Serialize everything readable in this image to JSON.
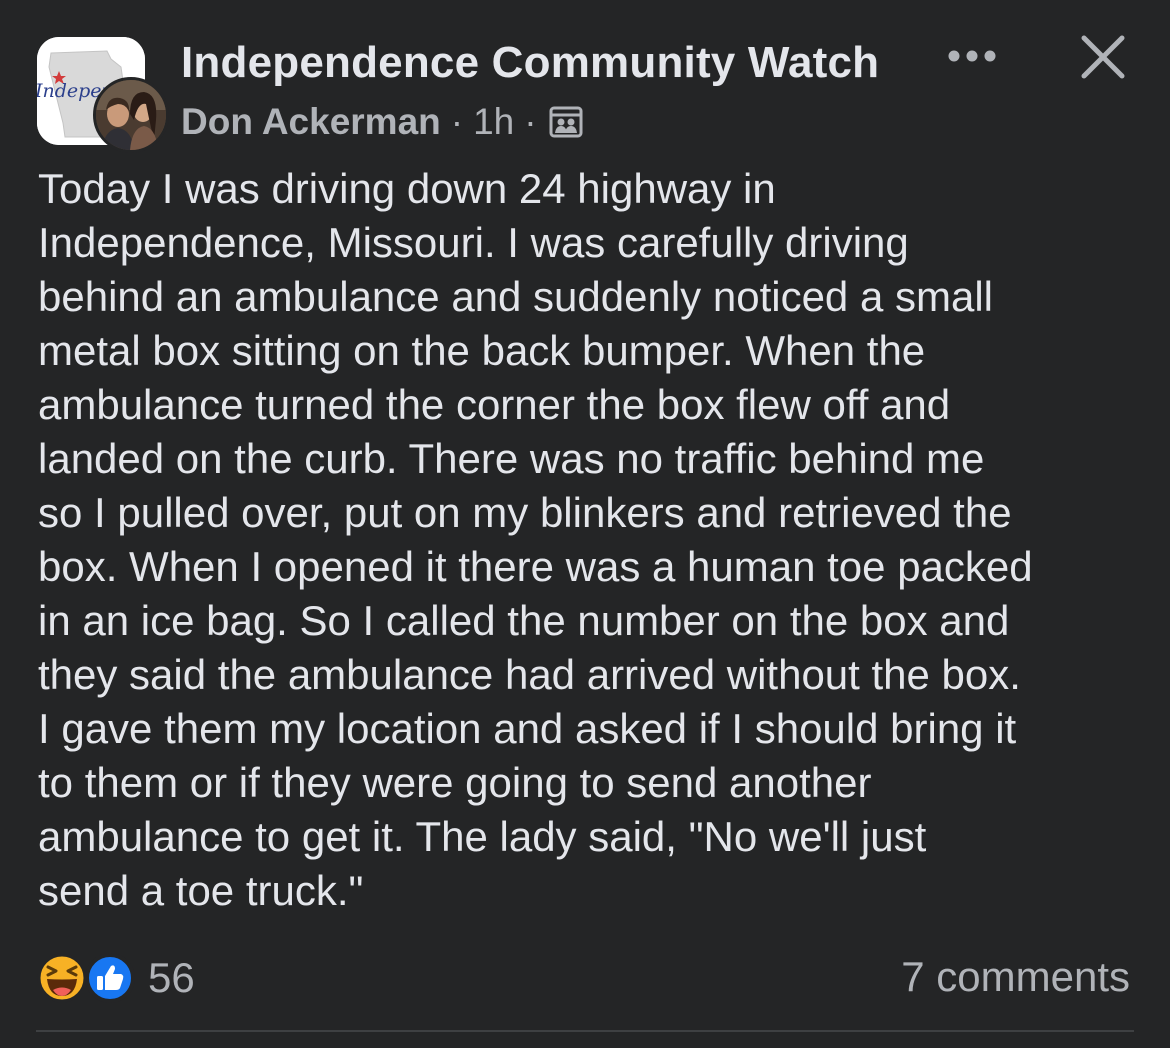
{
  "header": {
    "group_name": "Independence Community Watch",
    "group_logo_text": "Indepen",
    "author": "Don Ackerman",
    "separator": "·",
    "time": "1h",
    "audience_icon": "group-members-icon",
    "more_icon": "more-dots-icon",
    "close_icon": "close-icon"
  },
  "post": {
    "lines": [
      "Today I was driving down 24 highway in",
      "Independence, Missouri. I was carefully driving",
      "behind an ambulance and suddenly noticed a small",
      "metal box sitting on the back bumper. When the",
      "ambulance turned the corner the box flew off and",
      "landed on the curb. There was no traffic behind me",
      "so I pulled over, put on my blinkers and retrieved the",
      "box. When I opened it there was a human toe packed",
      "in an ice bag. So I called the number on the box and",
      "they said the ambulance had arrived without the box.",
      "I gave them my location and asked if I should bring it",
      "to them or if they were going to send another",
      "ambulance to get it. The lady said, \"No we'll just",
      "send a toe truck.\""
    ]
  },
  "footer": {
    "reactions": [
      "haha-icon",
      "like-icon"
    ],
    "reaction_count": "56",
    "comments": "7 comments"
  },
  "colors": {
    "background": "#242526",
    "primary_text": "#e4e6eb",
    "secondary_text": "#b0b3b8",
    "like_blue": "#1877f2",
    "haha_yellow": "#f7b125"
  }
}
